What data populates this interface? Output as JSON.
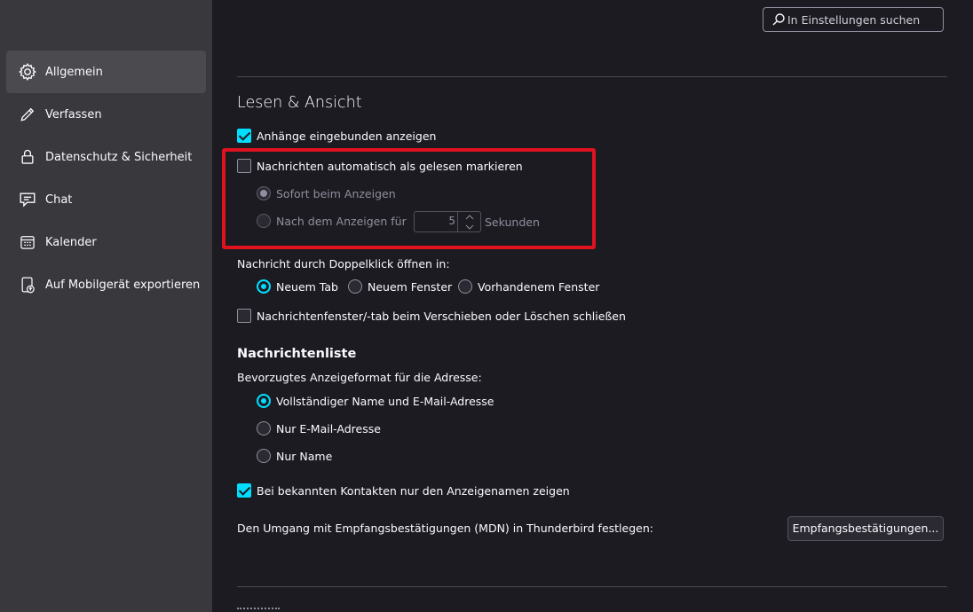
{
  "sidebar": {
    "items": [
      {
        "label": "Allgemein",
        "icon": "gear-icon",
        "active": true
      },
      {
        "label": "Verfassen",
        "icon": "pencil-icon",
        "active": false
      },
      {
        "label": "Datenschutz & Sicherheit",
        "icon": "lock-icon",
        "active": false
      },
      {
        "label": "Chat",
        "icon": "chat-icon",
        "active": false
      },
      {
        "label": "Kalender",
        "icon": "calendar-icon",
        "active": false
      },
      {
        "label": "Auf Mobilgerät exportieren",
        "icon": "mobile-export-icon",
        "active": false
      }
    ]
  },
  "search": {
    "placeholder": "In Einstellungen suchen"
  },
  "reading": {
    "title": "Lesen & Ansicht",
    "show_attachments_inline": {
      "label": "Anhänge eingebunden anzeigen",
      "checked": true
    },
    "auto_mark_read": {
      "label": "Nachrichten automatisch als gelesen markieren",
      "checked": false
    },
    "immediately": {
      "label": "Sofort beim Anzeigen",
      "selected": true,
      "disabled": true
    },
    "after_delay": {
      "label": "Nach dem Anzeigen für",
      "selected": false,
      "disabled": true
    },
    "delay_value": "5",
    "delay_unit": "Sekunden",
    "open_by_doubleclick_label": "Nachricht durch Doppelklick öffnen in:",
    "open_options": [
      {
        "label": "Neuem Tab",
        "selected": true
      },
      {
        "label": "Neuem Fenster",
        "selected": false
      },
      {
        "label": "Vorhandenem Fenster",
        "selected": false
      }
    ],
    "close_on_move": {
      "label": "Nachrichtenfenster/-tab beim Verschieben oder Löschen schließen",
      "checked": false
    }
  },
  "message_list": {
    "title": "Nachrichtenliste",
    "address_format_label": "Bevorzugtes Anzeigeformat für die Adresse:",
    "address_options": [
      {
        "label": "Vollständiger Name und E-Mail-Adresse",
        "selected": true
      },
      {
        "label": "Nur E-Mail-Adresse",
        "selected": false
      },
      {
        "label": "Nur Name",
        "selected": false
      }
    ],
    "known_contacts_display_name": {
      "label": "Bei bekannten Kontakten nur den Anzeigenamen zeigen",
      "checked": true
    },
    "mdn_label": "Den Umgang mit Empfangsbestätigungen (MDN) in Thunderbird festlegen:",
    "mdn_button": "Empfangsbestätigungen..."
  },
  "colors": {
    "accent": "#00ddff",
    "highlight": "#e0121f",
    "sidebar_bg": "#38383d",
    "main_bg": "#1c1b22"
  }
}
